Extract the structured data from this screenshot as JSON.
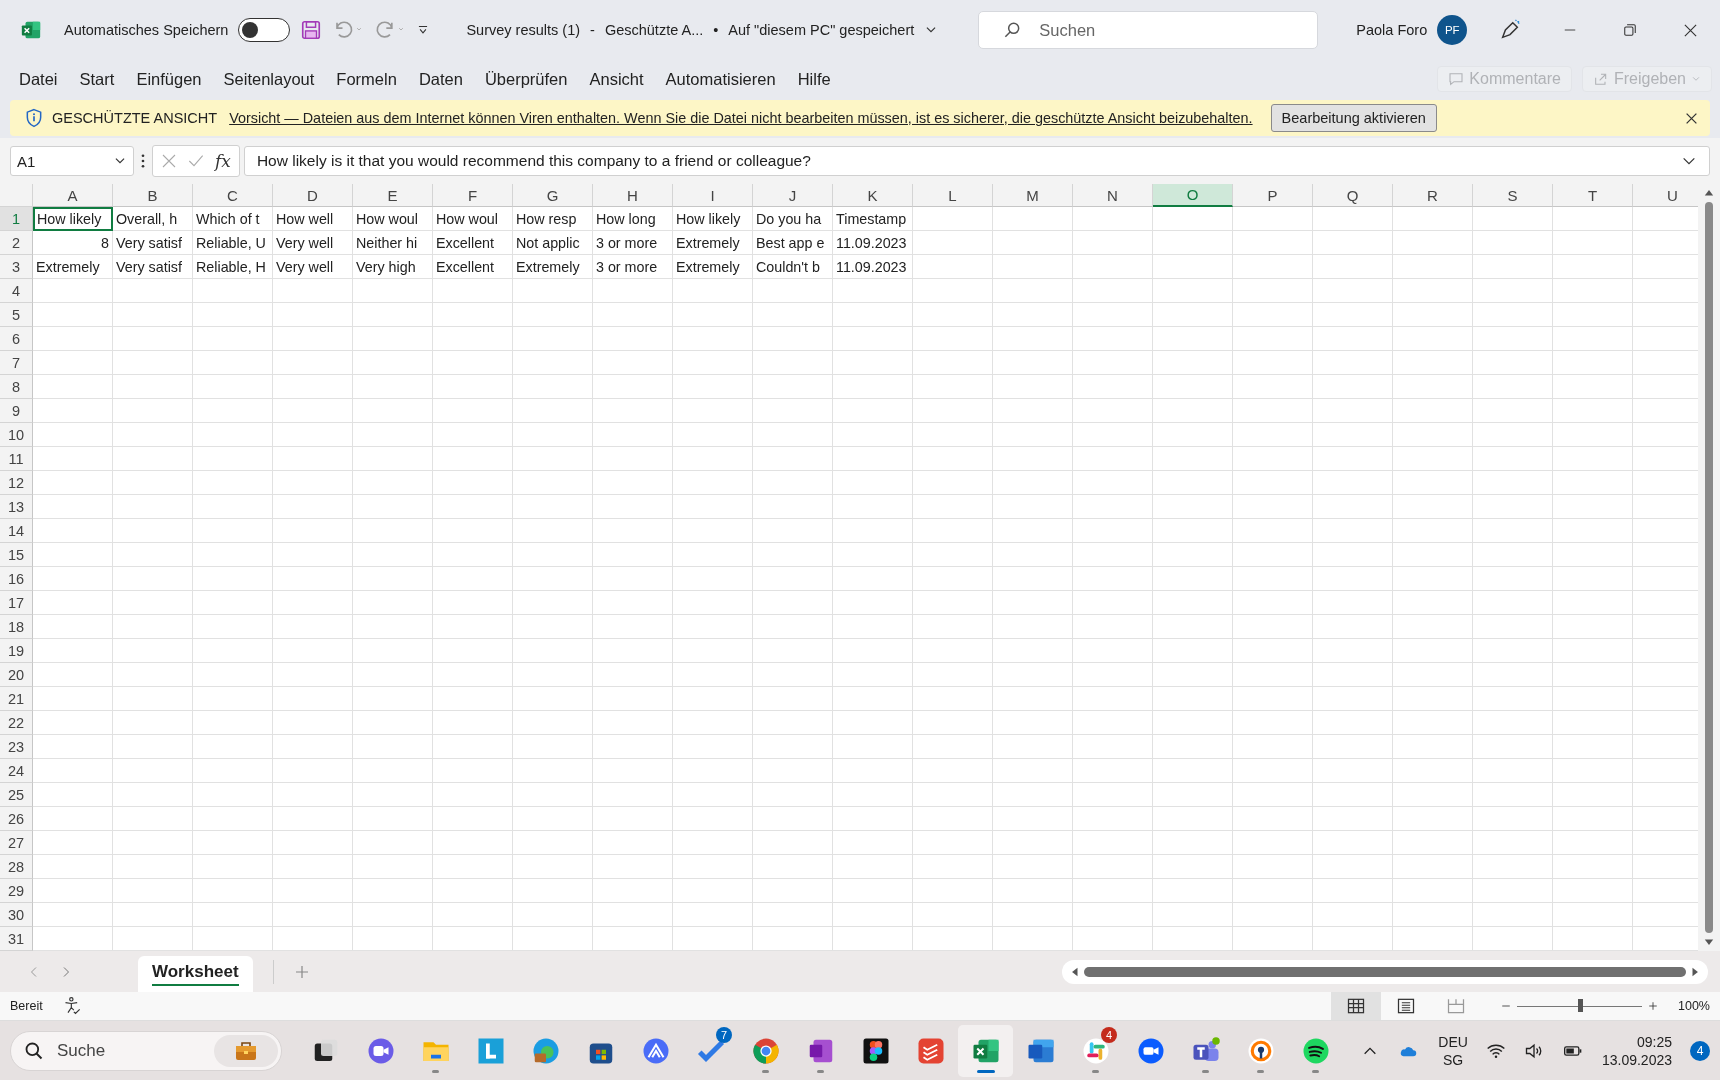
{
  "title_bar": {
    "autosave_label": "Automatisches Speichern",
    "autosave": {
      "on": false
    },
    "doc_title": "Survey results (1)",
    "separator": "-",
    "doc_state": "Geschützte A...",
    "bullet": "•",
    "doc_location": "Auf \"diesem PC\" gespeichert",
    "search": {
      "placeholder": "Suchen"
    },
    "user_name": "Paola Foro",
    "avatar": "PF"
  },
  "menu": {
    "items": [
      "Datei",
      "Start",
      "Einfügen",
      "Seitenlayout",
      "Formeln",
      "Daten",
      "Überprüfen",
      "Ansicht",
      "Automatisieren",
      "Hilfe"
    ],
    "buttons": [
      {
        "label": "Kommentare",
        "disabled": true
      },
      {
        "label": "Freigeben",
        "disabled": true
      }
    ]
  },
  "banner": {
    "title": "GESCHÜTZTE ANSICHT",
    "message": "Vorsicht — Dateien aus dem Internet können Viren enthalten. Wenn Sie die Datei nicht bearbeiten müssen, ist es sicherer, die geschützte Ansicht beizubehalten.",
    "button": "Bearbeitung aktivieren"
  },
  "formula_bar": {
    "name_box": "A1",
    "function_label": "fx",
    "content": "How likely is it that you would recommend this company to a friend or colleague?"
  },
  "grid": {
    "columns": [
      {
        "label": "A",
        "highlighted": false
      },
      {
        "label": "B",
        "highlighted": false
      },
      {
        "label": "C",
        "highlighted": false
      },
      {
        "label": "D",
        "highlighted": false
      },
      {
        "label": "E",
        "highlighted": false
      },
      {
        "label": "F",
        "highlighted": false
      },
      {
        "label": "G",
        "highlighted": false
      },
      {
        "label": "H",
        "highlighted": false
      },
      {
        "label": "I",
        "highlighted": false
      },
      {
        "label": "J",
        "highlighted": false
      },
      {
        "label": "K",
        "highlighted": false
      },
      {
        "label": "L",
        "highlighted": false
      },
      {
        "label": "M",
        "highlighted": false
      },
      {
        "label": "N",
        "highlighted": false
      },
      {
        "label": "O",
        "highlighted": true
      },
      {
        "label": "P",
        "highlighted": false
      },
      {
        "label": "Q",
        "highlighted": false
      },
      {
        "label": "R",
        "highlighted": false
      },
      {
        "label": "S",
        "highlighted": false
      },
      {
        "label": "T",
        "highlighted": false
      },
      {
        "label": "U",
        "highlighted": false
      }
    ],
    "rows": [
      {
        "label": "1",
        "cells": [
          {
            "text": "How likely",
            "selected": true
          },
          {
            "text": "Overall, h",
            "selected": false
          },
          {
            "text": "Which of t",
            "selected": false
          },
          {
            "text": "How well",
            "selected": false
          },
          {
            "text": "How woul",
            "selected": false
          },
          {
            "text": "How woul",
            "selected": false
          },
          {
            "text": "How resp",
            "selected": false
          },
          {
            "text": "How long",
            "selected": false
          },
          {
            "text": "How likely",
            "selected": false
          },
          {
            "text": "Do you ha",
            "selected": false
          },
          {
            "text": "Timestamp",
            "selected": false
          }
        ]
      },
      {
        "label": "2",
        "cells": [
          {
            "text": "8",
            "kind": "number",
            "selected": false
          },
          {
            "text": "Very satisf",
            "selected": false
          },
          {
            "text": "Reliable, U",
            "selected": false
          },
          {
            "text": "Very well",
            "selected": false
          },
          {
            "text": "Neither hi",
            "selected": false
          },
          {
            "text": "Excellent",
            "selected": false
          },
          {
            "text": "Not applic",
            "selected": false
          },
          {
            "text": "3 or more",
            "selected": false
          },
          {
            "text": "Extremely",
            "selected": false
          },
          {
            "text": "Best app e",
            "selected": false
          },
          {
            "text": "11.09.2023",
            "selected": false
          }
        ]
      },
      {
        "label": "3",
        "cells": [
          {
            "text": "Extremely",
            "selected": false
          },
          {
            "text": "Very satisf",
            "selected": false
          },
          {
            "text": "Reliable, H",
            "selected": false
          },
          {
            "text": "Very well",
            "selected": false
          },
          {
            "text": "Very high",
            "selected": false
          },
          {
            "text": "Excellent",
            "selected": false
          },
          {
            "text": "Extremely",
            "selected": false
          },
          {
            "text": "3 or more",
            "selected": false
          },
          {
            "text": "Extremely",
            "selected": false
          },
          {
            "text": "Couldn't b",
            "selected": false
          },
          {
            "text": "11.09.2023",
            "selected": false
          }
        ]
      },
      {
        "label": "4"
      },
      {
        "label": "5"
      },
      {
        "label": "6"
      },
      {
        "label": "7"
      },
      {
        "label": "8"
      },
      {
        "label": "9"
      },
      {
        "label": "10"
      },
      {
        "label": "11"
      },
      {
        "label": "12"
      },
      {
        "label": "13"
      },
      {
        "label": "14"
      },
      {
        "label": "15"
      },
      {
        "label": "16"
      },
      {
        "label": "17"
      },
      {
        "label": "18"
      },
      {
        "label": "19"
      },
      {
        "label": "20"
      },
      {
        "label": "21"
      },
      {
        "label": "22"
      },
      {
        "label": "23"
      },
      {
        "label": "24"
      },
      {
        "label": "25"
      },
      {
        "label": "26"
      },
      {
        "label": "27"
      },
      {
        "label": "28"
      },
      {
        "label": "29"
      },
      {
        "label": "30"
      },
      {
        "label": "31"
      }
    ]
  },
  "sheet_tabs": [
    {
      "label": "Worksheet",
      "selected": true
    }
  ],
  "status_bar": {
    "status": "Bereit",
    "views": [
      {
        "kind": "normal",
        "selected": true
      },
      {
        "kind": "page-layout",
        "selected": false
      },
      {
        "kind": "page-break",
        "selected": false
      }
    ],
    "zoom": {
      "level": 0.5
    },
    "zoom_label": "100%"
  },
  "taskbar": {
    "search": {
      "placeholder": "Suche"
    },
    "apps": [
      {
        "kind": "task-view",
        "running": false,
        "active": false
      },
      {
        "kind": "video-chat",
        "running": false,
        "active": false
      },
      {
        "kind": "folder",
        "running": true,
        "active": false
      },
      {
        "kind": "tile-blue",
        "running": false,
        "active": false
      },
      {
        "kind": "edge",
        "running": false,
        "active": false
      },
      {
        "kind": "store",
        "running": false,
        "active": false
      },
      {
        "kind": "peak",
        "running": false,
        "active": false
      },
      {
        "kind": "check",
        "running": false,
        "active": false,
        "badge": "7"
      },
      {
        "kind": "chrome",
        "running": true,
        "active": false
      },
      {
        "kind": "onenote",
        "running": true,
        "active": false
      },
      {
        "kind": "figma",
        "running": false,
        "active": false
      },
      {
        "kind": "todoist",
        "running": false,
        "active": false
      },
      {
        "kind": "excel",
        "running": true,
        "active": true
      },
      {
        "kind": "word",
        "running": false,
        "active": false
      },
      {
        "kind": "slack",
        "running": true,
        "active": false,
        "badge": "4"
      },
      {
        "kind": "zoom",
        "running": false,
        "active": false
      },
      {
        "kind": "teams",
        "running": true,
        "active": false
      },
      {
        "kind": "vpn",
        "running": true,
        "active": false
      },
      {
        "kind": "spotify",
        "running": true,
        "active": false
      }
    ],
    "language": "DEU",
    "layout": "SG",
    "time": "09:25",
    "date": "13.09.2023",
    "notifications": "4"
  }
}
